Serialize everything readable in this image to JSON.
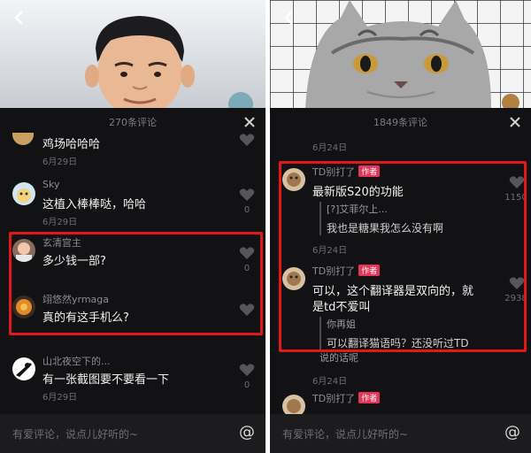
{
  "left": {
    "comment_count": "270条评论",
    "comments": [
      {
        "text": "鸡场哈哈哈",
        "date": "6月29日"
      },
      {
        "user": "Sky",
        "text": "这植入棒棒哒，哈哈",
        "date": "6月29日",
        "likes": "0"
      },
      {
        "user": "玄清宫主",
        "text": "多少钱一部?",
        "likes": "0"
      },
      {
        "user": "翊悠然yrmaga",
        "text": "真的有这手机么?"
      },
      {
        "user": "山北夜空下的...",
        "text": "有一张截图要不要看一下",
        "date": "6月29日",
        "likes": "0"
      }
    ],
    "input_placeholder": "有爱评论，说点儿好听的~"
  },
  "right": {
    "comment_count": "1849条评论",
    "top_date": "6月24日",
    "comments": [
      {
        "user": "TD别打了",
        "badge": "作者",
        "text": "最新版S20的功能",
        "reply_user": "[?]艾菲尔上...",
        "reply_text": "我也是糖果我怎么没有啊",
        "date": "6月24日",
        "likes": "1150"
      },
      {
        "user": "TD别打了",
        "badge": "作者",
        "text_line1": "可以，这个翻译器是双向的，就",
        "text_line2": "是td不爱叫",
        "reply_user": "你再姐",
        "reply_text": "可以翻译猫语吗？还没听过TD",
        "reply_tail": "说的话呢",
        "date": "6月24日",
        "likes": "2938"
      },
      {
        "user": "TD别打了",
        "badge": "作者"
      }
    ],
    "input_placeholder": "有爱评论，说点儿好听的~"
  },
  "icons": {
    "back": "chevron-left-icon",
    "close": "close-icon",
    "like": "heart-icon",
    "mention": "at-icon"
  },
  "colors": {
    "highlight": "#e01818",
    "badge": "#e6345a"
  }
}
